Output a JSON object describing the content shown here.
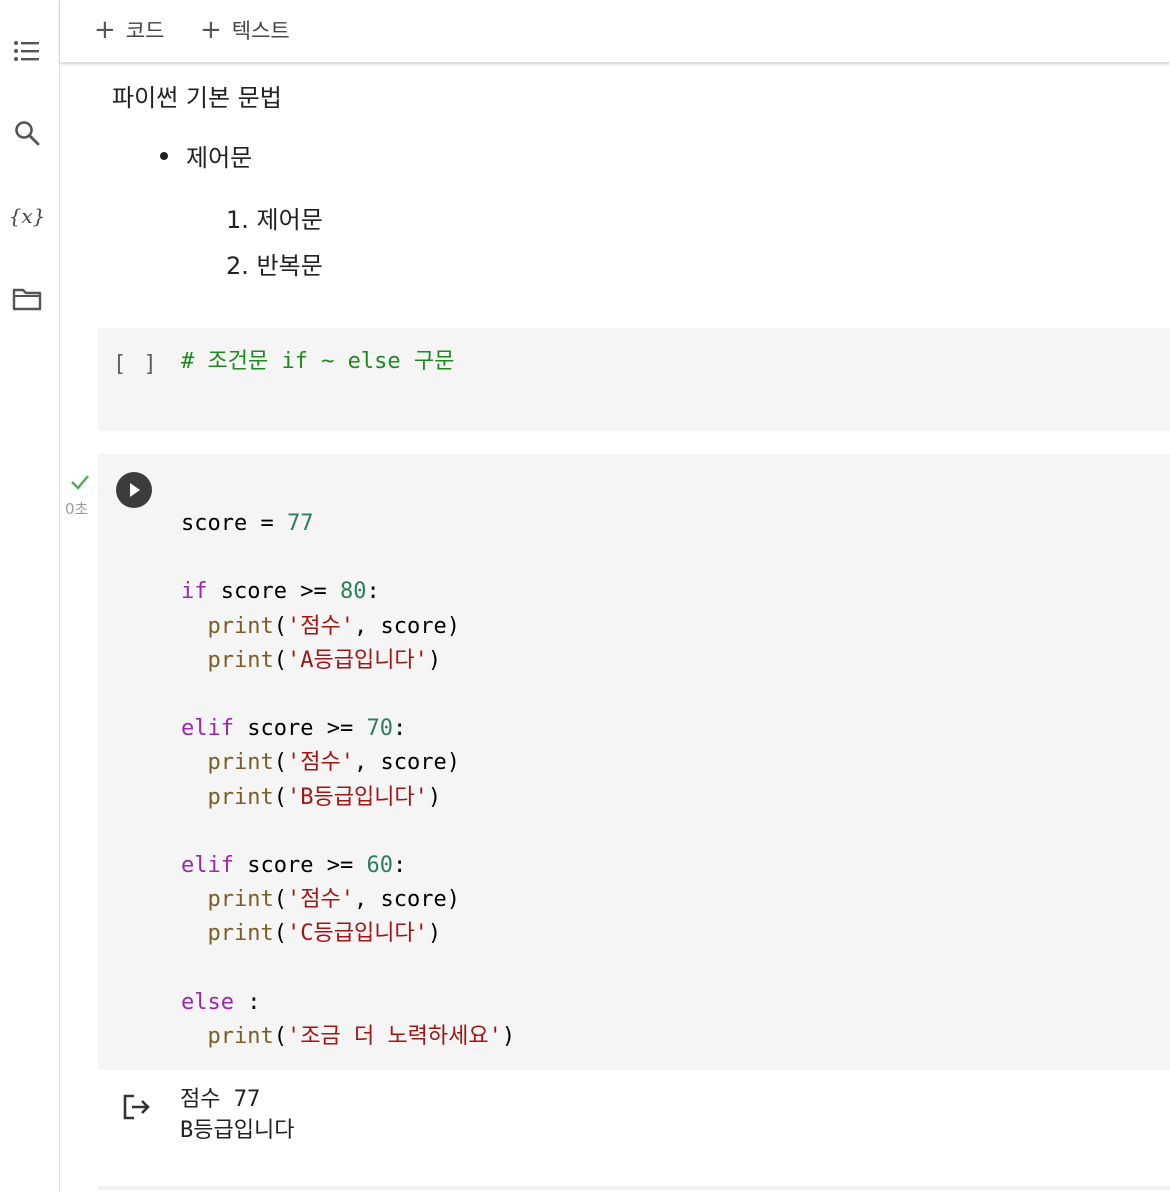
{
  "toolbar": {
    "add_code_label": "코드",
    "add_text_label": "텍스트"
  },
  "sidebar": {
    "items": [
      {
        "icon": "toc-icon"
      },
      {
        "icon": "search-icon"
      },
      {
        "icon": "variables-icon",
        "label": "{x}"
      },
      {
        "icon": "folder-icon"
      }
    ]
  },
  "text_cell": {
    "title": "파이썬 기본 문법",
    "bullet": "제어문",
    "ordered": [
      "제어문",
      "반복문"
    ]
  },
  "code_cell_1": {
    "bracket": "[ ]",
    "comment": "# 조건문 if ~ else 구문"
  },
  "code_cell_2": {
    "exec_time": "0초",
    "var": "score",
    "eq": "=",
    "score_value": "77",
    "kw_if": "if",
    "kw_elif": "elif",
    "kw_else": "else",
    "op": ">=",
    "t80": "80",
    "t70": "70",
    "t60": "60",
    "fn": "print",
    "s_score": "'점수'",
    "s_a": "'A등급입니다'",
    "s_b": "'B등급입니다'",
    "s_c": "'C등급입니다'",
    "s_else": "'조금 더 노력하세요'"
  },
  "output": {
    "line1": "점수 77",
    "line2": "B등급입니다"
  },
  "colors": {
    "keyword": "#9c27b0",
    "number": "#2e7d5b",
    "string": "#a31515",
    "function": "#795e26",
    "comment": "#1e8a1e",
    "cell_bg": "#f5f5f5",
    "success": "#4caf50"
  }
}
